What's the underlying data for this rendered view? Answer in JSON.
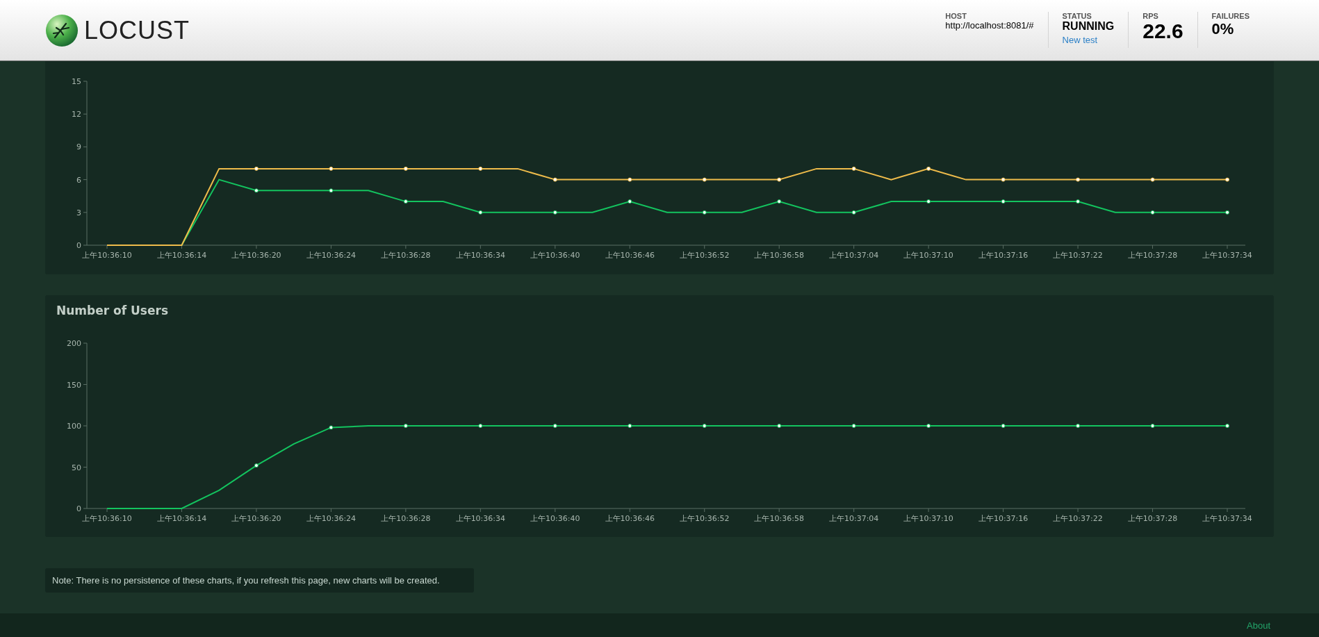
{
  "header": {
    "brand": "LOCUST",
    "stats": [
      {
        "kind": "host",
        "label": "HOST",
        "value": "http://localhost:8081/#"
      },
      {
        "kind": "status",
        "label": "STATUS",
        "value": "RUNNING",
        "link": "New test"
      },
      {
        "kind": "rps",
        "label": "RPS",
        "value": "22.6"
      },
      {
        "kind": "failures",
        "label": "FAILURES",
        "value": "0%"
      }
    ]
  },
  "charts": [
    {
      "chart_data": {
        "type": "line",
        "categories": [
          "上午10:36:10",
          null,
          "上午10:36:14",
          null,
          "上午10:36:20",
          null,
          "上午10:36:24",
          null,
          "上午10:36:28",
          null,
          "上午10:36:34",
          null,
          "上午10:36:40",
          null,
          "上午10:36:46",
          null,
          "上午10:36:52",
          null,
          "上午10:36:58",
          null,
          "上午10:37:04",
          null,
          "上午10:37:10",
          null,
          "上午10:37:16",
          null,
          "上午10:37:22",
          null,
          "上午10:37:28",
          null,
          "上午10:37:34"
        ],
        "ylim": [
          0,
          15
        ],
        "yticks": [
          0,
          3,
          6,
          9,
          12,
          15
        ],
        "series": [
          {
            "color": "#13c45f",
            "values": [
              0,
              0,
              0,
              6,
              5,
              5,
              5,
              5,
              4,
              4,
              3,
              3,
              3,
              3,
              4,
              3,
              3,
              3,
              4,
              3,
              3,
              4,
              4,
              4,
              4,
              4,
              4,
              3,
              3,
              3,
              3
            ]
          },
          {
            "color": "#efbc4b",
            "values": [
              0,
              0,
              0,
              7,
              7,
              7,
              7,
              7,
              7,
              7,
              7,
              7,
              6,
              6,
              6,
              6,
              6,
              6,
              6,
              7,
              7,
              6,
              7,
              6,
              6,
              6,
              6,
              6,
              6,
              6,
              6
            ]
          }
        ]
      }
    },
    {
      "chart_data": {
        "type": "line",
        "title": "Number of Users",
        "categories": [
          "上午10:36:10",
          null,
          "上午10:36:14",
          null,
          "上午10:36:20",
          null,
          "上午10:36:24",
          null,
          "上午10:36:28",
          null,
          "上午10:36:34",
          null,
          "上午10:36:40",
          null,
          "上午10:36:46",
          null,
          "上午10:36:52",
          null,
          "上午10:36:58",
          null,
          "上午10:37:04",
          null,
          "上午10:37:10",
          null,
          "上午10:37:16",
          null,
          "上午10:37:22",
          null,
          "上午10:37:28",
          null,
          "上午10:37:34"
        ],
        "ylim": [
          0,
          200
        ],
        "yticks": [
          0,
          50,
          100,
          150,
          200
        ],
        "series": [
          {
            "color": "#13c45f",
            "values": [
              0,
              0,
              0,
              22,
              52,
              78,
              98,
              100,
              100,
              100,
              100,
              100,
              100,
              100,
              100,
              100,
              100,
              100,
              100,
              100,
              100,
              100,
              100,
              100,
              100,
              100,
              100,
              100,
              100,
              100,
              100
            ]
          }
        ]
      }
    }
  ],
  "note": "Note: There is no persistence of these charts, if you refresh this page, new charts will be created.",
  "footer": {
    "link": "About"
  }
}
